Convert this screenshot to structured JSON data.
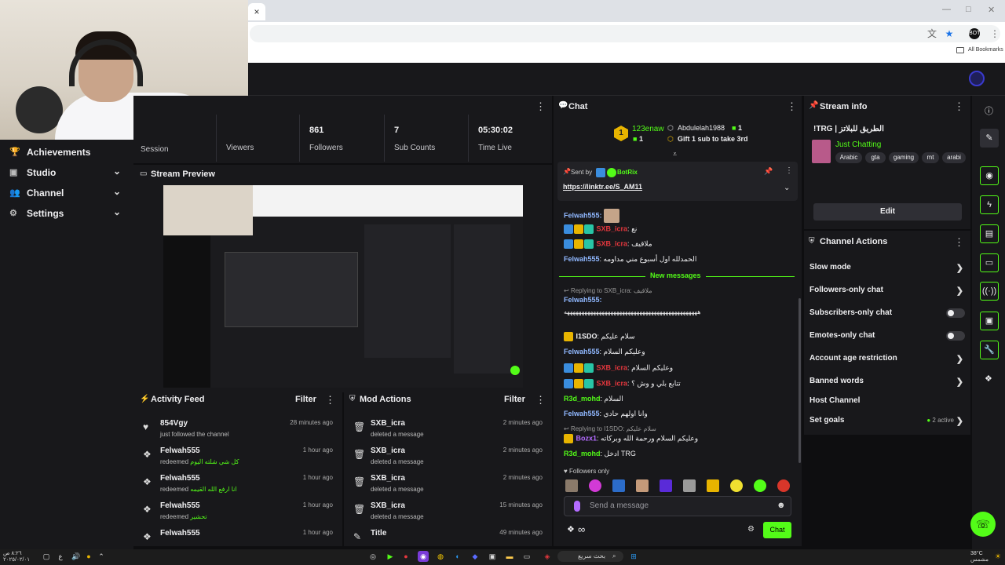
{
  "colors": {
    "accent": "#53fc18",
    "panel": "#18181b",
    "bg": "#0e0e10",
    "chat_name": "#90b8ff",
    "red_name": "#e5373d"
  },
  "browser": {
    "bookmarks_label": "All Bookmarks",
    "tab_close": "×"
  },
  "sidebar": {
    "items": [
      {
        "label": "Achievements",
        "icon": "trophy-icon"
      },
      {
        "label": "Studio",
        "icon": "studio-icon"
      },
      {
        "label": "Channel",
        "icon": "people-icon"
      },
      {
        "label": "Settings",
        "icon": "gear-icon"
      }
    ]
  },
  "stats": {
    "tabs": [
      {
        "value": "",
        "label": "Session"
      },
      {
        "value": "",
        "label": "Viewers"
      },
      {
        "value": "861",
        "label": "Followers"
      },
      {
        "value": "7",
        "label": "Sub Counts"
      },
      {
        "value": "05:30:02",
        "label": "Time Live"
      }
    ]
  },
  "preview": {
    "title": "Stream Preview"
  },
  "activity": {
    "title": "Activity Feed",
    "filter": "Filter",
    "rows": [
      {
        "user": "854Vgy",
        "text": "just followed the channel",
        "highlight": "",
        "time": "28 minutes ago",
        "icon": "heart-icon"
      },
      {
        "user": "Felwah555",
        "text": "redeemed",
        "highlight": "كل شي شلته اليوم",
        "time": "1 hour ago",
        "icon": "points-icon"
      },
      {
        "user": "Felwah555",
        "text": "redeemed",
        "highlight": "انا ارفع الله القيمه",
        "time": "1 hour ago",
        "icon": "points-icon"
      },
      {
        "user": "Felwah555",
        "text": "redeemed",
        "highlight": "تحشير",
        "time": "1 hour ago",
        "icon": "points-icon"
      },
      {
        "user": "Felwah555",
        "text": "",
        "highlight": "",
        "time": "1 hour ago",
        "icon": "points-icon"
      }
    ]
  },
  "mod": {
    "title": "Mod Actions",
    "filter": "Filter",
    "rows": [
      {
        "user": "SXB_icra",
        "text": "deleted a message",
        "time": "2 minutes ago"
      },
      {
        "user": "SXB_icra",
        "text": "deleted a message",
        "time": "2 minutes ago"
      },
      {
        "user": "SXB_icra",
        "text": "deleted a message",
        "time": "2 minutes ago"
      },
      {
        "user": "SXB_icra",
        "text": "deleted a message",
        "time": "15 minutes ago"
      },
      {
        "user": "Title",
        "text": "",
        "time": "49 minutes ago"
      }
    ]
  },
  "chat": {
    "title": "Chat",
    "gifters": {
      "rank": "1",
      "user1": "123enaw",
      "count1": "1",
      "user2": "Abdulelah1988",
      "count2": "1",
      "goal": "Gift 1 sub to take 3rd"
    },
    "pinned": {
      "sent_by": "Sent by",
      "bot": "BotRix",
      "link": "https://linktr.ee/S_AM11"
    },
    "new_messages": "New messages",
    "messages": [
      {
        "user": "Felwah555",
        "text": "",
        "red": false
      },
      {
        "user": "SXB_icra",
        "text": "نع",
        "red": true
      },
      {
        "user": "SXB_icra",
        "text": "ملاقيف",
        "red": true
      },
      {
        "user": "Felwah555",
        "text": "الحمدلله اول أسبوع مني مداومه",
        "red": false
      }
    ],
    "reply1": "Replying to SXB_icra: ملاقيف",
    "msg_after": [
      {
        "user": "Felwah555",
        "text": "",
        "red": false
      },
      {
        "user": "",
        "text": "ههههههههههههههههههههههههههههههههههههههههههههههه",
        "red": false
      },
      {
        "user": "I1SDO",
        "text": "سلام عليكم",
        "red": false
      },
      {
        "user": "Felwah555",
        "text": "وعليكم السلام",
        "red": false
      },
      {
        "user": "SXB_icra",
        "text": "وعليكم السلام",
        "red": true
      },
      {
        "user": "SXB_icra",
        "text": "تتابع بلي و وش ؟",
        "red": true
      },
      {
        "user": "R3d_mohd",
        "text": "السلام",
        "red": false
      },
      {
        "user": "Felwah555",
        "text": "وانا اولهم حادي",
        "red": false
      }
    ],
    "reply2": "Replying to I1SDO: سلام عليكم",
    "msg_last": [
      {
        "user": "Bozx1",
        "text": "وعليكم السلام ورحمة الله وبركاته"
      },
      {
        "user": "R3d_mohd",
        "text": "ادخل TRG"
      }
    ],
    "followers_only": "Followers only",
    "input_placeholder": "Send a message",
    "send": "Chat",
    "infinity": "∞"
  },
  "stream_info": {
    "title": "Stream info",
    "stream_title": "!TRG | الطريق للبلاتز",
    "category": "Just Chatting",
    "tags": [
      "Arabic",
      "gta",
      "gaming",
      "mt",
      "arabi"
    ],
    "edit": "Edit"
  },
  "channel_actions": {
    "title": "Channel Actions",
    "rows": [
      {
        "label": "Slow mode",
        "kind": "chevron"
      },
      {
        "label": "Followers-only chat",
        "kind": "chevron"
      },
      {
        "label": "Subscribers-only chat",
        "kind": "toggle"
      },
      {
        "label": "Emotes-only chat",
        "kind": "toggle"
      },
      {
        "label": "Account age restriction",
        "kind": "chevron"
      },
      {
        "label": "Banned words",
        "kind": "chevron"
      },
      {
        "label": "Host Channel",
        "kind": "none"
      },
      {
        "label": "Set goals",
        "kind": "chevron"
      }
    ],
    "goals_status": "2 active"
  },
  "taskbar": {
    "search": "بحث سريع",
    "time": "٨:٢٦ ص",
    "date": "٢٠٢٥/٠٢/٠١",
    "weather": "38°C",
    "weather_label": "مشمس"
  }
}
